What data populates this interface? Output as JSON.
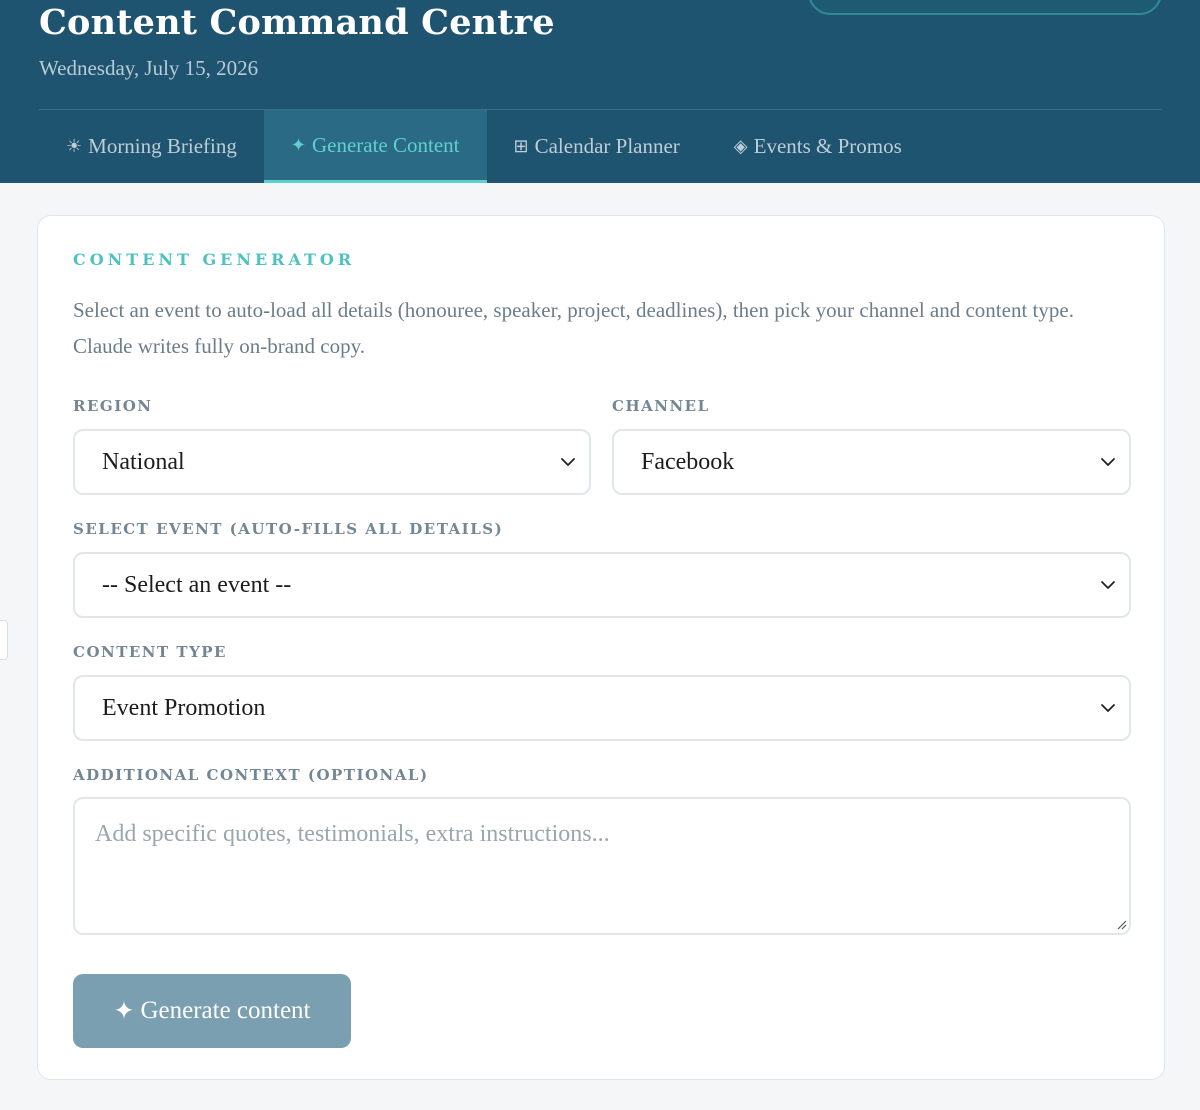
{
  "header": {
    "title": "Content Command Centre",
    "date": "Wednesday, July 15, 2026",
    "tabs": [
      {
        "icon": "☀",
        "label": "Morning Briefing",
        "active": false
      },
      {
        "icon": "✦",
        "label": "Generate Content",
        "active": true
      },
      {
        "icon": "⊞",
        "label": "Calendar Planner",
        "active": false
      },
      {
        "icon": "◈",
        "label": "Events & Promos",
        "active": false
      }
    ]
  },
  "generator": {
    "section_title": "CONTENT GENERATOR",
    "description": "Select an event to auto-load all details (honouree, speaker, project, deadlines), then pick your channel and content type. Claude writes fully on-brand copy.",
    "region": {
      "label": "REGION",
      "value": "National"
    },
    "channel": {
      "label": "CHANNEL",
      "value": "Facebook"
    },
    "event": {
      "label": "SELECT EVENT (AUTO-FILLS ALL DETAILS)",
      "value": "-- Select an event --"
    },
    "content_type": {
      "label": "CONTENT TYPE",
      "value": "Event Promotion"
    },
    "context": {
      "label": "ADDITIONAL CONTEXT (OPTIONAL)",
      "placeholder": "Add specific quotes, testimonials, extra instructions..."
    },
    "generate_button": {
      "icon": "✦",
      "label": "Generate content"
    }
  },
  "colors": {
    "header_bg": "#1f5470",
    "accent": "#5fd0cc",
    "button_bg": "#7a9fb0"
  }
}
